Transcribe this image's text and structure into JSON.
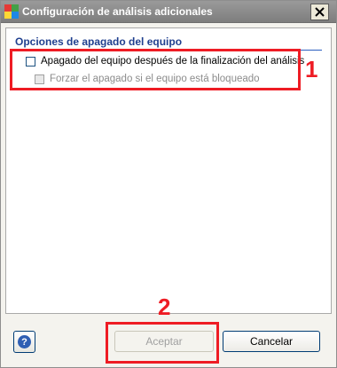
{
  "window": {
    "title": "Configuración de análisis adicionales",
    "close_glyph": "✕"
  },
  "section": {
    "title": "Opciones de apagado del equipo"
  },
  "options": [
    {
      "label": "Apagado del equipo después de la finalización del análisis",
      "checked": false,
      "enabled": true
    },
    {
      "label": "Forzar el apagado si el equipo está bloqueado",
      "checked": false,
      "enabled": false
    }
  ],
  "annotations": {
    "marker_1": "1",
    "marker_2": "2",
    "color": "#ee1c24"
  },
  "buttons": {
    "help_glyph": "?",
    "accept_label": "Aceptar",
    "accept_enabled": false,
    "cancel_label": "Cancelar"
  },
  "icons": {
    "app": "avg-app-icon",
    "close": "close-icon",
    "help": "help-icon"
  }
}
